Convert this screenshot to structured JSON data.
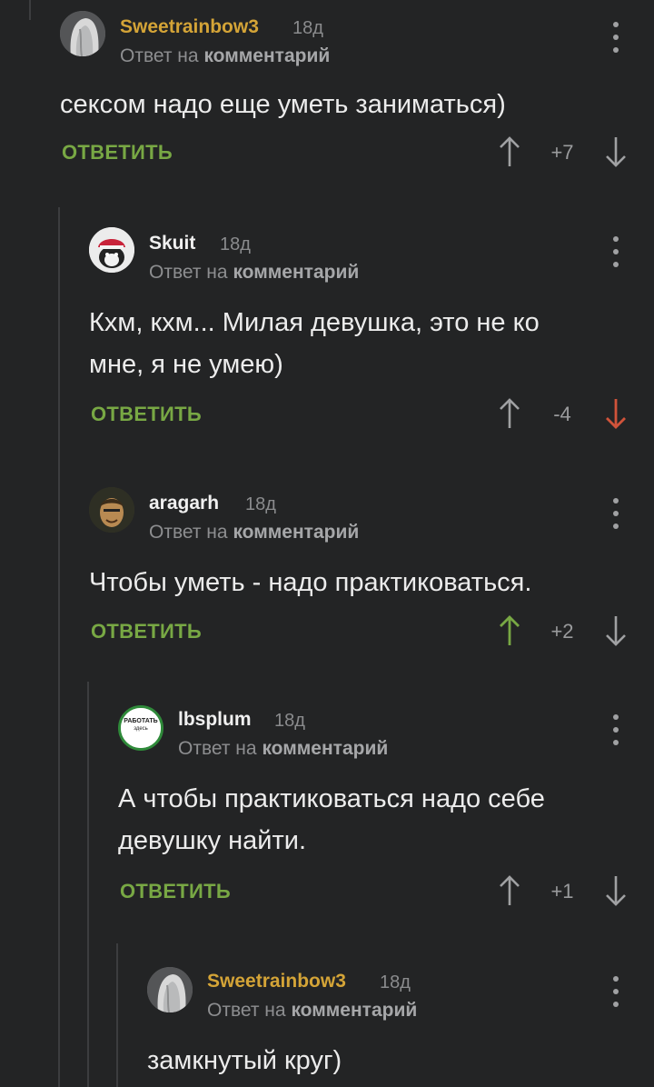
{
  "comments": [
    {
      "username": "Sweetrainbow3",
      "username_color": "#d4a437",
      "time": "18д",
      "reply_prefix": "Ответ на",
      "reply_target": "комментарий",
      "text_lines": [
        "сексом надо еще уметь заниматься)"
      ],
      "reply_label": "ОТВЕТИТЬ",
      "score": "+7",
      "vote": "none",
      "avatar": "grey-hair-avatar"
    },
    {
      "username": "Skuit",
      "username_color": "#f0f0f0",
      "time": "18д",
      "reply_prefix": "Ответ на",
      "reply_target": "комментарий",
      "text_lines": [
        "Кхм, кхм... Милая девушка, это не ко",
        "мне, я не умею)"
      ],
      "reply_label": "ОТВЕТИТЬ",
      "score": "-4",
      "vote": "down",
      "avatar": "cartoon-avatar"
    },
    {
      "username": "aragarh",
      "username_color": "#f0f0f0",
      "time": "18д",
      "reply_prefix": "Ответ на",
      "reply_target": "комментарий",
      "text_lines": [
        "Чтобы уметь - надо практиковаться."
      ],
      "reply_label": "ОТВЕТИТЬ",
      "score": "+2",
      "vote": "up",
      "avatar": "face-avatar"
    },
    {
      "username": "lbsplum",
      "username_color": "#f0f0f0",
      "time": "18д",
      "reply_prefix": "Ответ на",
      "reply_target": "комментарий",
      "text_lines": [
        "А чтобы практиковаться надо себе",
        "девушку найти."
      ],
      "reply_label": "ОТВЕТИТЬ",
      "score": "+1",
      "vote": "none",
      "avatar": "badge-avatar",
      "avatar_text": [
        "РАБОТАТЬ",
        "здесь"
      ]
    },
    {
      "username": "Sweetrainbow3",
      "username_color": "#d4a437",
      "time": "18д",
      "reply_prefix": "Ответ на",
      "reply_target": "комментарий",
      "text_lines": [
        "замкнутый круг)"
      ],
      "avatar": "grey-hair-avatar"
    }
  ],
  "colors": {
    "background": "#232425",
    "reply_green": "#78a844",
    "upvote_active": "#78a844",
    "downvote_active": "#d0533a",
    "vote_inactive": "#a0a1a3",
    "thread_line": "#3c3d3f"
  }
}
